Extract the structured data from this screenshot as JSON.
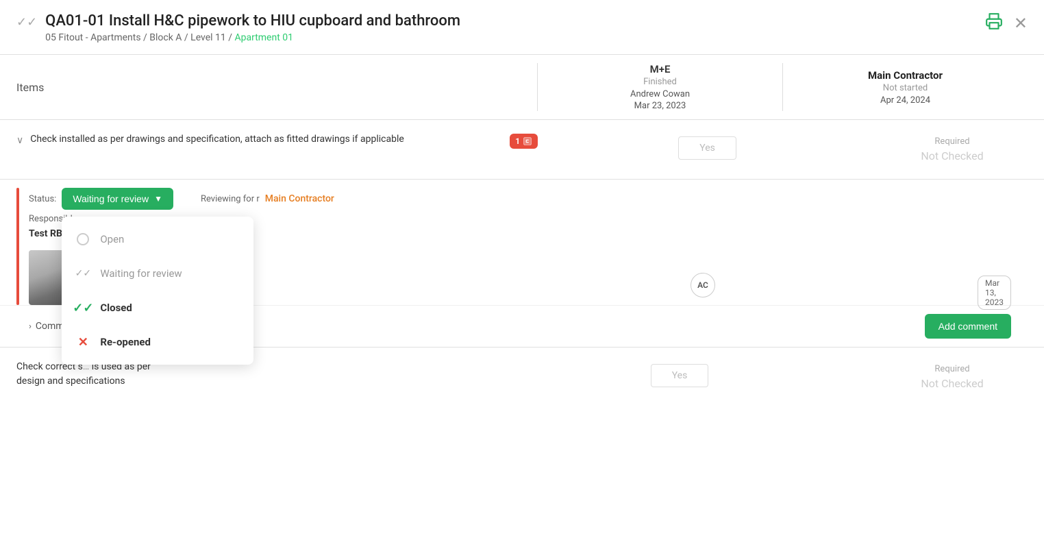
{
  "header": {
    "check_icon": "✓✓",
    "title": "QA01-01 Install H&C pipework to HIU cupboard and bathroom",
    "breadcrumb": "05 Fitout - Apartments / Block A / Level 11 /",
    "breadcrumb_link": "Apartment 01",
    "print_icon": "🖨",
    "close_icon": "✕"
  },
  "columns": {
    "items_label": "Items",
    "me_name": "M+E",
    "me_status": "Finished",
    "me_user": "Andrew Cowan",
    "me_date": "Mar 23, 2023",
    "mc_name": "Main Contractor",
    "mc_status": "Not started",
    "mc_date": "Apr 24, 2024"
  },
  "check_row_1": {
    "text": "Check installed as per drawings and specification, attach as fitted drawings if applicable",
    "badge": "1",
    "yes_label": "Yes",
    "required_label": "Required",
    "not_checked_label": "Not Checked"
  },
  "expanded": {
    "status_label": "Status:",
    "status_value": "Waiting for review",
    "responsible_label": "Responsible:",
    "responsible_name": "Test RB",
    "reviewing_label": "ewing:",
    "reviewing_value": "Main Contractor",
    "ac_avatar": "AC",
    "date_badge": "Mar 13, 2023"
  },
  "dropdown": {
    "items": [
      {
        "id": "open",
        "label": "Open",
        "icon_type": "circle",
        "active": false
      },
      {
        "id": "waiting",
        "label": "Waiting for review",
        "icon_type": "check-gray",
        "active": true
      },
      {
        "id": "closed",
        "label": "Closed",
        "icon_type": "check-green",
        "active": false
      },
      {
        "id": "reopened",
        "label": "Re-opened",
        "icon_type": "x-red",
        "active": false
      }
    ]
  },
  "comments": {
    "label": "Comments",
    "add_button": "Add comment"
  },
  "check_row_2": {
    "text_part1": "Check correct s",
    "text_part2": "is used as per",
    "text_part3": "design and specifications",
    "yes_label": "Yes",
    "required_label": "Required",
    "not_checked_label": "Not Checked"
  }
}
